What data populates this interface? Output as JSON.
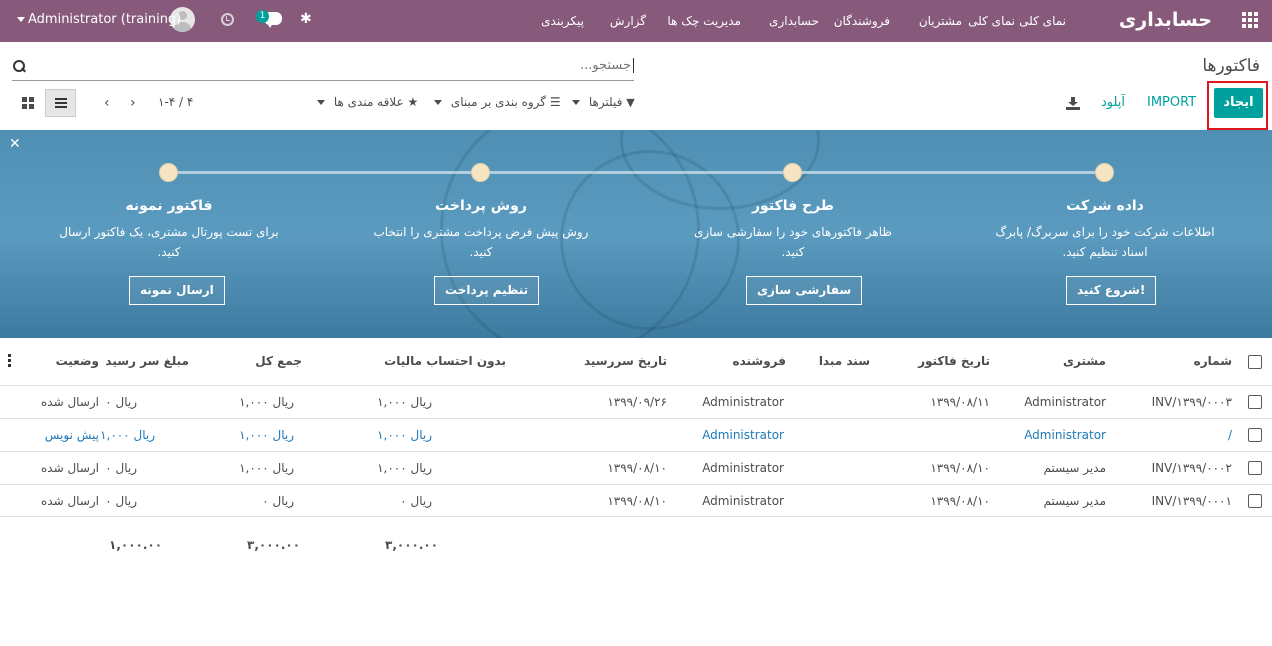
{
  "topbar": {
    "brand": "حسابداری",
    "menus": [
      "نمای کلی",
      "نمای کلی",
      "مشتریان",
      "فروشندگان",
      "حسابداری",
      "مدیریت چک ها",
      "گزارش",
      "پیکربندی"
    ],
    "user": "Administrator (training)",
    "chat_badge": "1"
  },
  "page": {
    "title": "فاکتورها",
    "search_placeholder": "جستجو..."
  },
  "toolbar": {
    "create": "ایجاد",
    "import": "IMPORT",
    "upload": "آپلود",
    "filters": "فیلترها",
    "group_by": "گروه بندی بر مبنای",
    "favorites": "علاقه مندی ها",
    "pager": "۱-۴ / ۴"
  },
  "onboarding": {
    "steps": [
      {
        "title": "داده شرکت",
        "desc": "اطلاعات شرکت خود را برای سربرگ/ پابرگ اسناد تنظیم کنید.",
        "button": "شروع کنید!"
      },
      {
        "title": "طرح فاکتور",
        "desc": "ظاهر فاکتورهای خود را سفارشی سازی کنید.",
        "button": "سفارشی سازی"
      },
      {
        "title": "روش پرداخت",
        "desc": "روش پیش فرض پرداخت مشتری را انتخاب کنید.",
        "button": "تنظیم پرداخت"
      },
      {
        "title": "فاکتور نمونه",
        "desc": "برای تست پورتال مشتری، یک فاکتور ارسال کنید.",
        "button": "ارسال نمونه"
      }
    ]
  },
  "table": {
    "headers": {
      "number": "شماره",
      "customer": "مشتری",
      "invoice_date": "تاریخ فاکتور",
      "source": "سند مبدا",
      "salesperson": "فروشنده",
      "due_date": "تاریخ سررسید",
      "untaxed": "بدون احتساب مالیات",
      "total": "جمع کل",
      "amount_due": "مبلغ سر رسید",
      "status": "وضعیت"
    },
    "rows": [
      {
        "number": "INV/۱۳۹۹/۰۰۰۳",
        "customer": "Administrator",
        "invoice_date": "۱۳۹۹/۰۸/۱۱",
        "source": "",
        "salesperson": "Administrator",
        "due_date": "۱۳۹۹/۰۹/۲۶",
        "untaxed": "۱,۰۰۰ ریال",
        "total": "۱,۰۰۰ ریال",
        "amount_due": "۰ ریال",
        "status": "ارسال شده"
      },
      {
        "number": "/",
        "customer": "Administrator",
        "invoice_date": "",
        "source": "",
        "salesperson": "Administrator",
        "due_date": "",
        "untaxed": "۱,۰۰۰ ریال",
        "total": "۱,۰۰۰ ریال",
        "amount_due": "۱,۰۰۰ ریال",
        "status": "پیش نویس"
      },
      {
        "number": "INV/۱۳۹۹/۰۰۰۲",
        "customer": "مدیر سیستم",
        "invoice_date": "۱۳۹۹/۰۸/۱۰",
        "source": "",
        "salesperson": "Administrator",
        "due_date": "۱۳۹۹/۰۸/۱۰",
        "untaxed": "۱,۰۰۰ ریال",
        "total": "۱,۰۰۰ ریال",
        "amount_due": "۰ ریال",
        "status": "ارسال شده"
      },
      {
        "number": "INV/۱۳۹۹/۰۰۰۱",
        "customer": "مدیر سیستم",
        "invoice_date": "۱۳۹۹/۰۸/۱۰",
        "source": "",
        "salesperson": "Administrator",
        "due_date": "۱۳۹۹/۰۸/۱۰",
        "untaxed": "۰ ریال",
        "total": "۰ ریال",
        "amount_due": "۰ ریال",
        "status": "ارسال شده"
      }
    ],
    "totals": {
      "untaxed": "۳,۰۰۰.۰۰",
      "total": "۳,۰۰۰.۰۰",
      "amount_due": "۱,۰۰۰.۰۰"
    }
  },
  "colors": {
    "topbar": "#875a7b",
    "accent": "#00a09d",
    "highlight": "#e0161d",
    "draft": "#1f7ab8"
  }
}
